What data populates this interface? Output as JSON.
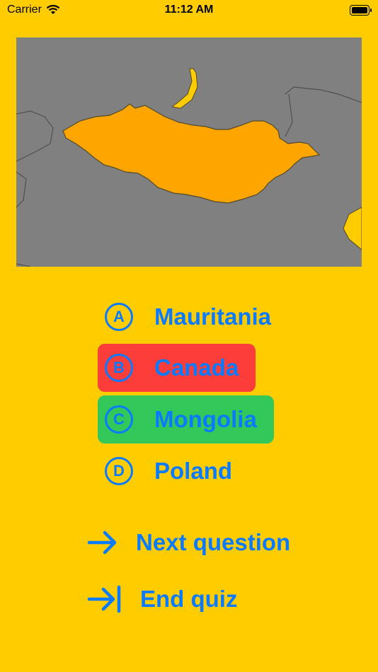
{
  "status_bar": {
    "carrier": "Carrier",
    "time": "11:12 AM"
  },
  "map": {
    "highlight_color": "#ffa500",
    "land_color": "#808080",
    "other_color": "#ffcc00"
  },
  "answers": [
    {
      "letter": "A",
      "label": "Mauritania",
      "state": "none"
    },
    {
      "letter": "B",
      "label": "Canada",
      "state": "wrong"
    },
    {
      "letter": "C",
      "label": "Mongolia",
      "state": "correct"
    },
    {
      "letter": "D",
      "label": "Poland",
      "state": "none"
    }
  ],
  "actions": {
    "next_label": "Next question",
    "end_label": "End quiz"
  },
  "colors": {
    "background": "#ffcc00",
    "accent": "#0a7aff",
    "wrong": "#fc3d39",
    "correct": "#34c759"
  }
}
